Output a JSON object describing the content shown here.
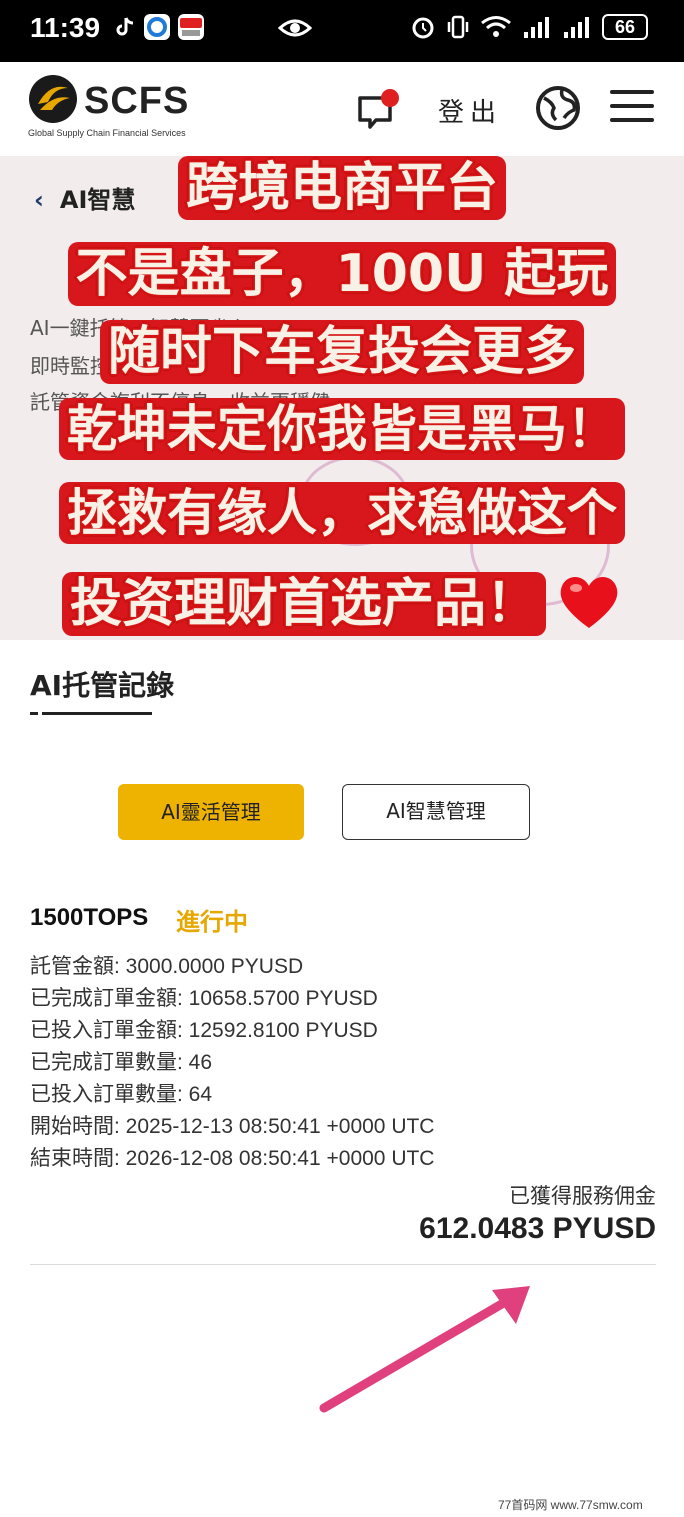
{
  "status_bar": {
    "time": "11:39",
    "battery": "66",
    "icons": [
      "tiktok-icon",
      "app-icon",
      "news-app-icon",
      "eye-icon",
      "alarm-icon",
      "vibrate-icon",
      "wifi-icon",
      "signal-icon",
      "signal-icon",
      "battery-icon"
    ]
  },
  "header": {
    "logo_text": "SCFS",
    "logo_sub": "Global Supply Chain Financial Services",
    "logout_label": "登出",
    "icons": [
      "message-icon",
      "globe-icon",
      "menu-icon"
    ],
    "notification_dot_color": "#e02020"
  },
  "banner": {
    "back_label": "AI智慧",
    "faded_lines": [
      "AI一鍵托管，智慧更省心",
      "即時監控，智能",
      "託管資金複利不停息，收益更穩健"
    ]
  },
  "promo_lines": [
    "跨境电商平台",
    "不是盘子，100U 起玩",
    "随时下车复投会更多",
    "乾坤未定你我皆是黑马！",
    "拯救有缘人，求稳做这个",
    "投资理财首选产品！"
  ],
  "records": {
    "title": "AI托管記錄",
    "tabs": [
      {
        "label": "AI靈活管理",
        "active": true
      },
      {
        "label": "AI智慧管理",
        "active": false
      }
    ],
    "plan": {
      "name": "1500TOPS",
      "status": "進行中",
      "status_color": "#e6a800",
      "details": [
        "託管金額:  3000.0000 PYUSD",
        "已完成訂單金額: 10658.5700 PYUSD",
        "已投入訂單金額: 12592.8100 PYUSD",
        "已完成訂單數量: 46",
        "已投入訂單數量: 64",
        "開始時間: 2025-12-13 08:50:41 +0000 UTC",
        "結束時間: 2026-12-08 08:50:41 +0000 UTC"
      ],
      "earned_label": "已獲得服務佣金",
      "earned_value": "612.0483 PYUSD"
    }
  },
  "watermark": "77首码网 www.77smw.com",
  "colors": {
    "accent_yellow": "#eeb200",
    "promo_red": "#d8171c",
    "arrow_pink": "#e0407e"
  }
}
